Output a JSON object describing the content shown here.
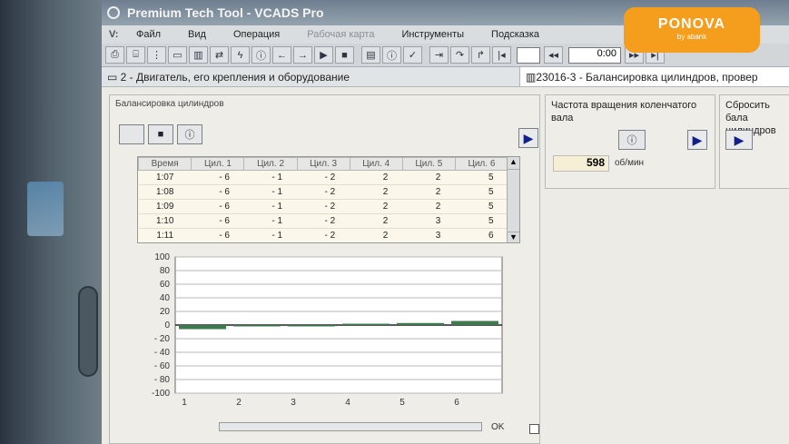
{
  "app": {
    "title": "Premium Tech Tool - VCADS Pro"
  },
  "menu": {
    "logo": "V:",
    "items": [
      {
        "label": "Файл",
        "enabled": true
      },
      {
        "label": "Вид",
        "enabled": true
      },
      {
        "label": "Операция",
        "enabled": true
      },
      {
        "label": "Рабочая карта",
        "enabled": false
      },
      {
        "label": "Инструменты",
        "enabled": true
      },
      {
        "label": "Подсказка",
        "enabled": true
      }
    ]
  },
  "toolbar": {
    "time_value": "0:00"
  },
  "pathbar": {
    "left": "2 - Двигатель, его крепления и оборудование",
    "right": "23016-3 - Балансировка цилиндров, провер"
  },
  "balance_panel": {
    "label": "Балансировка цилиндров",
    "table": {
      "headers": [
        "Время",
        "Цил. 1",
        "Цил. 2",
        "Цил. 3",
        "Цил. 4",
        "Цил. 5",
        "Цил. 6"
      ],
      "rows": [
        [
          "1:07",
          "- 6",
          "- 1",
          "- 2",
          "2",
          "2",
          "5"
        ],
        [
          "1:08",
          "- 6",
          "- 1",
          "- 2",
          "2",
          "2",
          "5"
        ],
        [
          "1:09",
          "- 6",
          "- 1",
          "- 2",
          "2",
          "2",
          "5"
        ],
        [
          "1:10",
          "- 6",
          "- 1",
          "- 2",
          "2",
          "3",
          "5"
        ],
        [
          "1:11",
          "- 6",
          "- 1",
          "- 2",
          "2",
          "3",
          "6"
        ]
      ]
    },
    "ok_label": "OK"
  },
  "chart_data": {
    "type": "bar",
    "categories": [
      "1",
      "2",
      "3",
      "4",
      "5",
      "6"
    ],
    "values": [
      -6,
      -1,
      -2,
      2,
      3,
      6
    ],
    "ylim": [
      -100,
      100
    ],
    "yticks": [
      "100",
      "80",
      "60",
      "40",
      "20",
      "0",
      "- 20",
      "- 40",
      "- 60",
      "- 80",
      "-100"
    ],
    "grid": true,
    "bar_color": "#3f7a4e"
  },
  "rpm_panel": {
    "label": "Частота вращения коленчатого вала",
    "value": "598",
    "unit": "об/мин"
  },
  "reset_panel": {
    "label": "Сбросить бала цилиндров"
  },
  "watermark": {
    "brand": "PONOVA",
    "sub": "by abank"
  }
}
